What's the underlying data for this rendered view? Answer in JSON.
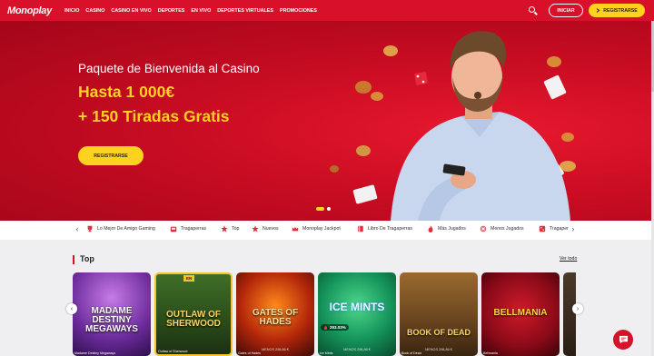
{
  "header": {
    "logo": "Monoplay",
    "nav": [
      "INICIO",
      "CASINO",
      "CASINO EN VIVO",
      "DEPORTES",
      "EN VIVO",
      "DEPORTES VIRTUALES",
      "PROMOCIONES"
    ],
    "login_label": "INICIAR",
    "register_label": "REGISTRARSE",
    "register_icon": "arrow-right-icon"
  },
  "hero": {
    "subtitle": "Paquete de Bienvenida al Casino",
    "line1": "Hasta 1 000€",
    "line2": "+ 150 Tiradas Gratis",
    "cta": "REGISTRARSE"
  },
  "categories": [
    {
      "label": "Lo Mejor De Amigo Gaming",
      "icon": "trophy-icon"
    },
    {
      "label": "Tragaperras",
      "icon": "slot-machine-icon"
    },
    {
      "label": "Top",
      "icon": "star-icon"
    },
    {
      "label": "Nuevos",
      "icon": "star-icon"
    },
    {
      "label": "Monoplay Jackpot",
      "icon": "crown-icon"
    },
    {
      "label": "Libro De Tragaperras",
      "icon": "book-icon"
    },
    {
      "label": "Más Jugados",
      "icon": "fire-icon"
    },
    {
      "label": "Menos Jugados",
      "icon": "snowflake-icon"
    },
    {
      "label": "Tragaper",
      "icon": "dice-icon"
    }
  ],
  "section": {
    "title": "Top",
    "see_all": "Ver todo"
  },
  "games": [
    {
      "title": "MADAME DESTINY MEGAWAYS",
      "jackpot": "",
      "badge": "",
      "caption": "Madame Destiny Megaways"
    },
    {
      "title": "OUTLAW OF SHERWOOD",
      "jackpot": "",
      "badge": "EN",
      "caption": "Outlaw of Sherwood"
    },
    {
      "title": "GATES OF HADES",
      "jackpot": "MENOS 298,86 €",
      "badge": "",
      "caption": "Gates of Hades"
    },
    {
      "title": "ICE MINTS",
      "jackpot": "MENOS 298,86 €",
      "badge": "293.03%",
      "caption": "Ice Mints"
    },
    {
      "title": "BOOK OF DEAD",
      "jackpot": "MENOS 298,86 €",
      "badge": "",
      "caption": "Book of Dead"
    },
    {
      "title": "BELLMANIA",
      "jackpot": "",
      "badge": "",
      "caption": "Bellmania"
    }
  ],
  "colors": {
    "brand_red": "#d8102a",
    "accent_yellow": "#ffd21f"
  }
}
